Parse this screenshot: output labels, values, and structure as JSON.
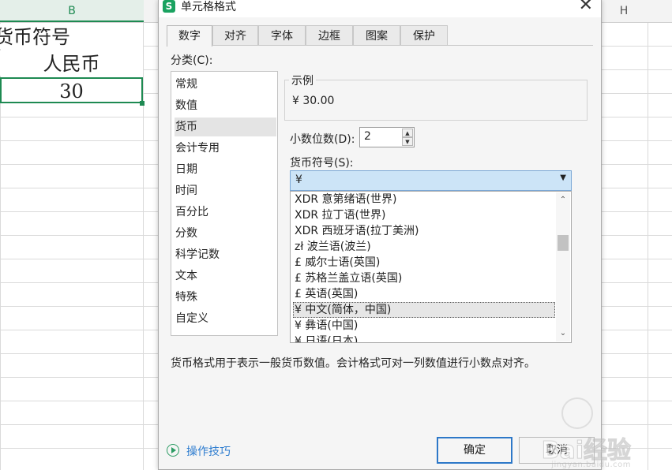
{
  "sheet": {
    "col_b": "B",
    "col_h": "H",
    "cells": [
      "货币符号",
      "人民币",
      "30"
    ]
  },
  "dialog": {
    "title": "单元格格式",
    "tabs": [
      "数字",
      "对齐",
      "字体",
      "边框",
      "图案",
      "保护"
    ],
    "active_tab": "数字",
    "category_label": "分类(C):",
    "categories": [
      "常规",
      "数值",
      "货币",
      "会计专用",
      "日期",
      "时间",
      "百分比",
      "分数",
      "科学记数",
      "文本",
      "特殊",
      "自定义"
    ],
    "selected_category": "货币",
    "sample_label": "示例",
    "sample_value": "¥ 30.00",
    "decimal_label": "小数位数(D):",
    "decimal_value": "2",
    "currency_label": "货币符号(S):",
    "currency_value": "¥",
    "currency_options": [
      "XDR 意第绪语(世界)",
      "XDR 拉丁语(世界)",
      "XDR 西班牙语(拉丁美洲)",
      "zł 波兰语(波兰)",
      "£ 威尔士语(英国)",
      "£ 苏格兰盖立语(英国)",
      "£ 英语(英国)",
      "¥ 中文(简体，中国)",
      "¥ 彝语(中国)",
      "¥ 日语(日本)"
    ],
    "selected_option_index": 7,
    "description": "货币格式用于表示一般货币数值。会计格式可对一列数值进行小数点对齐。",
    "tips_label": "操作技巧",
    "ok_label": "确定",
    "cancel_label": "取消"
  },
  "watermark": {
    "main": "Bai经验",
    "sub": "jingyan.baidu.com"
  },
  "colors": {
    "accent_green": "#1e8a52",
    "link_blue": "#2d7ccf",
    "ok_border": "#2d78c8",
    "combo_bg": "#cce4f7"
  }
}
